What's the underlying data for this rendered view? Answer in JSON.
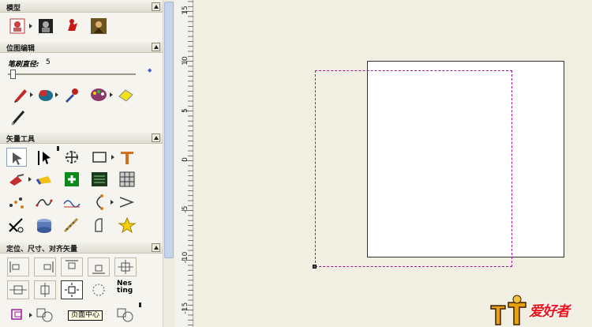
{
  "panel": {
    "sections": {
      "models": "模型",
      "bitmap": "位图编辑",
      "vector": "矢量工具",
      "align": "定位、尺寸、对齐矢量"
    },
    "brush_label": "笔刷直径:",
    "brush_value": "5",
    "brush_slider_fraction": 0.02,
    "nesting_label": "Nes ting"
  },
  "ruler": {
    "labels": [
      "15",
      "10",
      "5",
      "0",
      "-5",
      "-10",
      "-15"
    ]
  },
  "tooltip": {
    "text": "页面中心"
  },
  "logo": {
    "text": "爱好者"
  },
  "colors": {
    "selection": "#a016a0",
    "panel_bg": "#f5f4ee",
    "canvas_bg": "#f1efe2"
  }
}
